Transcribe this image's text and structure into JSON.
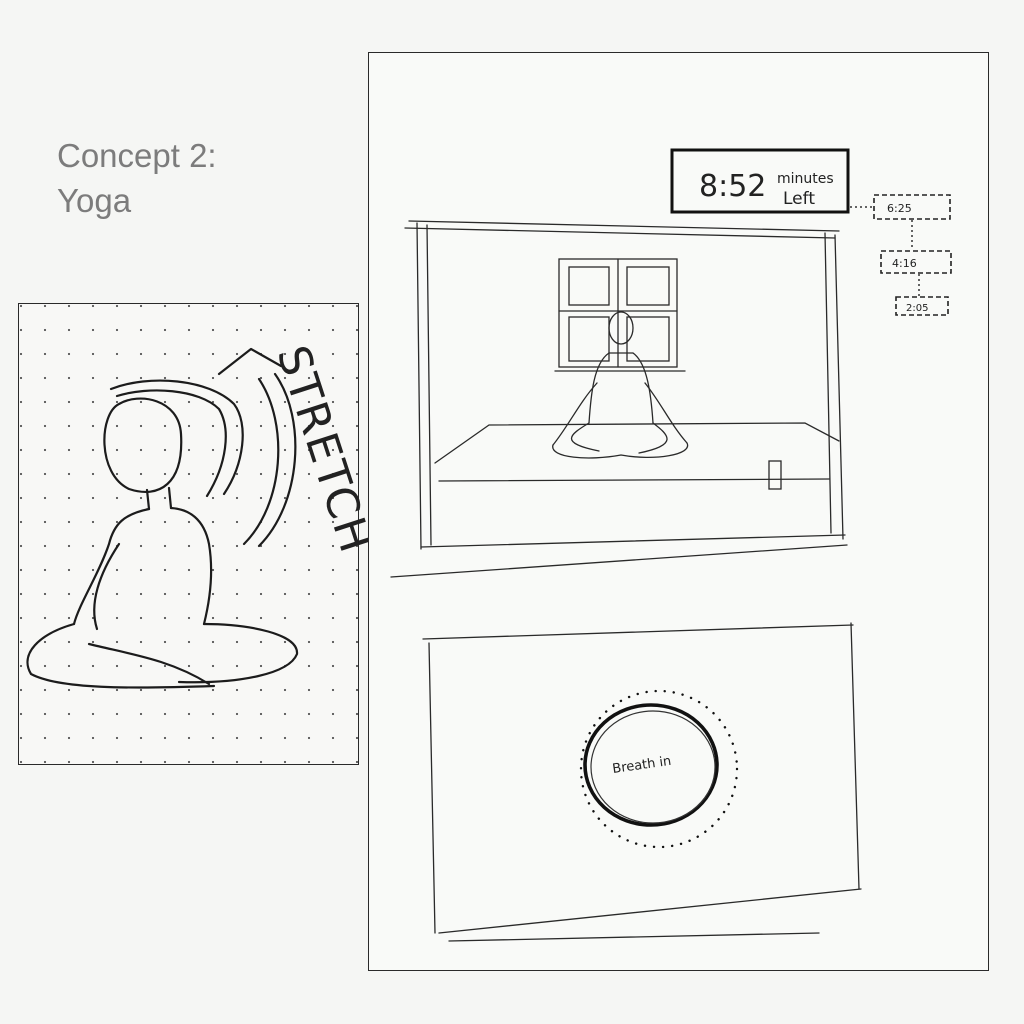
{
  "heading": {
    "line1": "Concept 2:",
    "line2": "Yoga"
  },
  "sketch_left": {
    "word": "STRETCH"
  },
  "sketch_right": {
    "timer": {
      "value": "8:52",
      "unit_line1": "minutes",
      "unit_line2": "Left"
    },
    "upcoming_times": [
      "6:25",
      "4:16",
      "2:05"
    ],
    "breath_prompt": "Breath in"
  },
  "colors": {
    "background": "#f5f6f4",
    "heading": "#7c7c7c",
    "ink": "#222222"
  }
}
